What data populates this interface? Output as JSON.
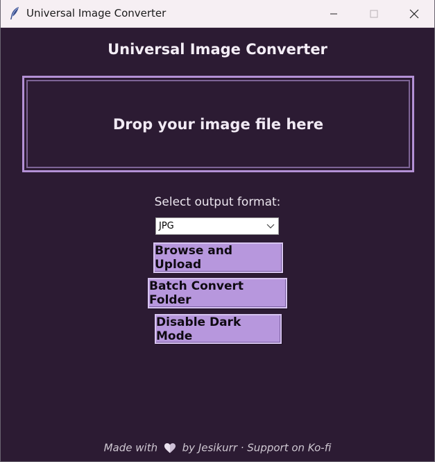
{
  "window": {
    "title": "Universal Image Converter"
  },
  "main": {
    "heading": "Universal Image Converter",
    "drop_zone_text": "Drop your image file here",
    "format_label": "Select output format:",
    "format_select": {
      "value": "JPG"
    },
    "buttons": {
      "browse": "Browse and Upload",
      "batch": "Batch Convert Folder",
      "dark_mode": "Disable Dark Mode"
    }
  },
  "footer": {
    "prefix": "Made with",
    "suffix": "by Jesikurr · Support on Ko-fi"
  },
  "colors": {
    "background": "#2c1b33",
    "accent": "#b797dd",
    "drop_border": "#b491d6"
  }
}
